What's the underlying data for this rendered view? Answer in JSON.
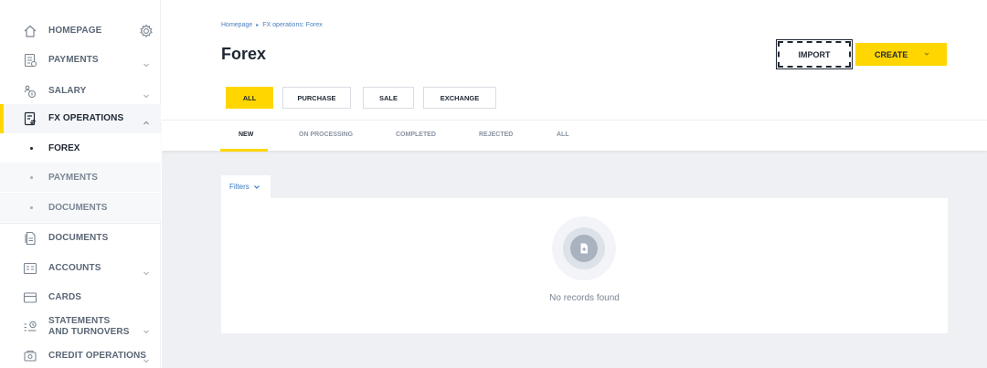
{
  "sidebar": {
    "items": [
      {
        "label": "HOMEPAGE",
        "icon": "home-icon"
      },
      {
        "label": "PAYMENTS",
        "icon": "payments-icon"
      },
      {
        "label": "SALARY",
        "icon": "salary-icon"
      },
      {
        "label": "FX OPERATIONS",
        "icon": "fx-icon"
      },
      {
        "label": "DOCUMENTS",
        "icon": "documents-icon"
      },
      {
        "label": "ACCOUNTS",
        "icon": "accounts-icon"
      },
      {
        "label": "CARDS",
        "icon": "cards-icon"
      },
      {
        "label": "STATEMENTS AND TURNOVERS",
        "icon": "statements-icon"
      },
      {
        "label": "CREDIT OPERATIONS",
        "icon": "credit-icon"
      }
    ],
    "fx_subitems": [
      {
        "label": "FOREX"
      },
      {
        "label": "PAYMENTS"
      },
      {
        "label": "DOCUMENTS"
      }
    ]
  },
  "header": {
    "breadcrumb": {
      "home": "Homepage",
      "separator": "▸",
      "current": "FX operations: Forex"
    },
    "title": "Forex",
    "import_label": "IMPORT",
    "create_label": "CREATE"
  },
  "segments": [
    {
      "label": "ALL",
      "active": true
    },
    {
      "label": "PURCHASE",
      "active": false
    },
    {
      "label": "SALE",
      "active": false
    },
    {
      "label": "EXCHANGE",
      "active": false
    }
  ],
  "status_tabs": [
    {
      "label": "NEW",
      "active": true
    },
    {
      "label": "ON PROCESSING",
      "active": false
    },
    {
      "label": "COMPLETED",
      "active": false
    },
    {
      "label": "REJECTED",
      "active": false
    },
    {
      "label": "ALL",
      "active": false
    }
  ],
  "filters": {
    "label": "Filters"
  },
  "empty_state": {
    "text": "No records found",
    "icon": "empty-document-icon"
  },
  "colors": {
    "accent": "#ffd600",
    "link": "#4a7fc1",
    "text": "#1f2733",
    "muted": "#8a94a2"
  }
}
